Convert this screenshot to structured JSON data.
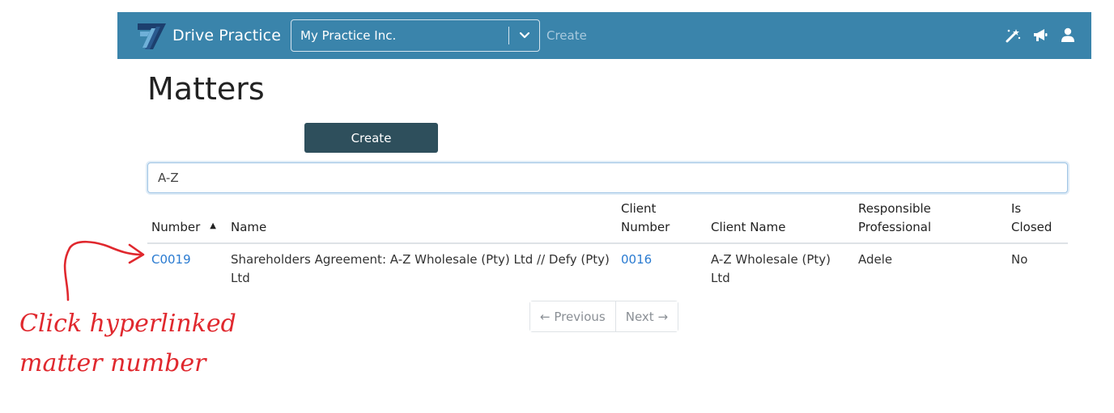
{
  "navbar": {
    "brand": "Drive Practice",
    "practice_select_value": "My Practice Inc.",
    "create_link": "Create",
    "icons": [
      "magic-wand-icon",
      "megaphone-icon",
      "user-icon"
    ],
    "color": "#3a84ab"
  },
  "page": {
    "title": "Matters",
    "create_button": "Create",
    "search_value": "A-Z"
  },
  "table": {
    "headers": {
      "number": "Number",
      "name": "Name",
      "client_number_line1": "Client",
      "client_number_line2": "Number",
      "client_name": "Client Name",
      "responsible_line1": "Responsible",
      "responsible_line2": "Professional",
      "is_closed_line1": "Is",
      "is_closed_line2": "Closed"
    },
    "sort": {
      "column": "Number",
      "direction": "ascending",
      "icon": "caret-up-icon"
    },
    "rows": [
      {
        "number": "C0019",
        "name": "Shareholders Agreement: A-Z Wholesale (Pty) Ltd // Defy (Pty) Ltd",
        "client_number": "0016",
        "client_name": "A-Z Wholesale (Pty) Ltd",
        "responsible": "Adele",
        "is_closed": "No"
      }
    ]
  },
  "pagination": {
    "previous": "← Previous",
    "next": "Next →"
  },
  "annotation": {
    "line1": "Click hyperlinked",
    "line2": "matter number",
    "color": "#e0282e"
  },
  "colors": {
    "link": "#2a7bd1",
    "create_button": "#2e4f5c"
  }
}
